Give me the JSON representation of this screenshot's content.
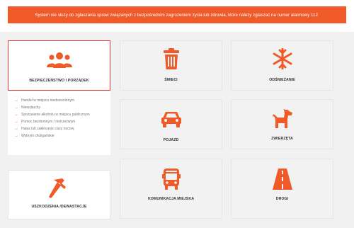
{
  "alert": {
    "text": "System nie służy do zgłaszania spraw związanych z bezpośrednim zagrożeniem życia lub zdrowia, które należy zgłaszać na numer alarmowy 112.",
    "color": "#f05a28"
  },
  "categories": [
    {
      "label": "BEZPIECZEŃSTWO I PORZĄDEK",
      "icon": "people-group-icon",
      "active": true
    },
    {
      "label": "ŚMIECI",
      "icon": "trash-icon"
    },
    {
      "label": "ODŚNIEŻANIE",
      "icon": "snowflake-icon"
    },
    {
      "label": "POJAZD",
      "icon": "car-icon"
    },
    {
      "label": "ZWIERZĘTA",
      "icon": "dog-icon"
    },
    {
      "label": "USZKODZENIA /DEWASTACJE",
      "icon": "hammer-icon"
    },
    {
      "label": "KOMUNIKACJA MIEJSKA",
      "icon": "bus-icon"
    },
    {
      "label": "DROGI",
      "icon": "road-icon"
    }
  ],
  "subcategories": [
    "Handel w miejscu niedozwolonym",
    "Niewybuchy",
    "Spożywanie alkoholu w miejscu publicznym",
    "Pomoc bezdomnym / nietrzeźwym",
    "Hałas lub zakłócanie ciszy nocnej",
    "Wybryki chuligańskie"
  ],
  "colors": {
    "accent": "#f05a28",
    "active_border": "#e53935"
  }
}
